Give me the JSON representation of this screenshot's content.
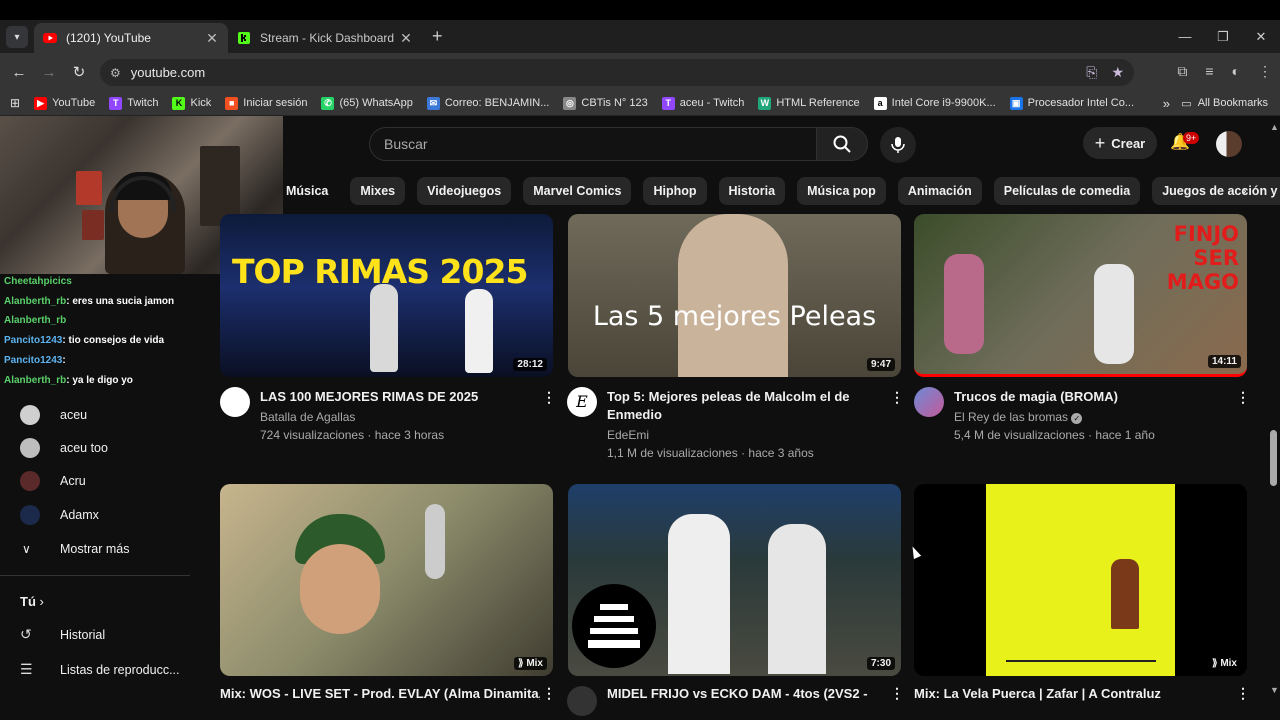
{
  "browser": {
    "tabs": [
      {
        "title": "(1201) YouTube",
        "favicon": "youtube-icon",
        "close": "✕"
      },
      {
        "title": "Stream - Kick Dashboard",
        "favicon": "kick-icon",
        "close": "✕"
      }
    ],
    "new_tab": "+",
    "url": "youtube.com",
    "bookmarks": [
      {
        "label": "YouTube",
        "color": "#ff0000",
        "glyph": "▶"
      },
      {
        "label": "Twitch",
        "color": "#9146ff",
        "glyph": "T"
      },
      {
        "label": "Kick",
        "color": "#53fc18",
        "glyph": "K"
      },
      {
        "label": "Iniciar sesión",
        "color": "#f25022",
        "glyph": "■"
      },
      {
        "label": "(65) WhatsApp",
        "color": "#25d366",
        "glyph": "✆"
      },
      {
        "label": "Correo: BENJAMIN...",
        "color": "#3c78d8",
        "glyph": "✉"
      },
      {
        "label": "CBTis N° 123",
        "color": "#888888",
        "glyph": "◎"
      },
      {
        "label": "aceu - Twitch",
        "color": "#9146ff",
        "glyph": "T"
      },
      {
        "label": "HTML Reference",
        "color": "#1fa67a",
        "glyph": "W"
      },
      {
        "label": "Intel Core i9-9900K...",
        "color": "#ffffff",
        "glyph": "a"
      },
      {
        "label": "Procesador Intel Co...",
        "color": "#1a73e8",
        "glyph": "▣"
      }
    ],
    "more_bookmarks": "»",
    "all_bookmarks": "All Bookmarks"
  },
  "stream_chat": [
    {
      "user": "Cheetahpicics",
      "msg": ""
    },
    {
      "user": "Alanberth_rb",
      "msg": ": eres una sucia jamon"
    },
    {
      "user": "Alanberth_rb",
      "msg": ""
    },
    {
      "user": "Pancito1243",
      "msg": ": tio consejos de vida"
    },
    {
      "user": "Pancito1243",
      "msg": ":"
    },
    {
      "user": "Alanberth_rb",
      "msg": ": ya le digo yo"
    }
  ],
  "sidebar": {
    "subscriptions": [
      {
        "name": "aceu",
        "color": "#cfcfcf"
      },
      {
        "name": "aceu too",
        "color": "#bdbdbd"
      },
      {
        "name": "Acru",
        "color": "#5a2a2a"
      },
      {
        "name": "Adamx",
        "color": "#1b2a4a"
      }
    ],
    "show_more": "Mostrar más",
    "you_section": "Tú",
    "history": "Historial",
    "playlists": "Listas de reproducc..."
  },
  "youtube": {
    "search_placeholder": "Buscar",
    "create_label": "Crear",
    "notif_badge": "9+",
    "chips": [
      "Música",
      "Mixes",
      "Videojuegos",
      "Marvel Comics",
      "Hiphop",
      "Historia",
      "Música pop",
      "Animación",
      "Películas de comedia",
      "Juegos de acción y aventuras"
    ],
    "videos_row1": [
      {
        "title": "LAS 100 MEJORES RIMAS DE 2025",
        "channel": "Batalla de Agallas",
        "meta": "724 visualizaciones · hace 3 horas",
        "duration": "28:12",
        "thumb_text": "TOP RIMAS 2025"
      },
      {
        "title": "Top 5: Mejores peleas de Malcolm el de Enmedio",
        "channel": "EdeEmi",
        "meta": "1,1 M de visualizaciones · hace 3 años",
        "duration": "9:47",
        "thumb_text": "Las 5 mejores Peleas"
      },
      {
        "title": "Trucos de magia (BROMA)",
        "channel": "El Rey de las bromas",
        "meta": "5,4 M de visualizaciones · hace 1 año",
        "duration": "14:11",
        "thumb_text": "FINJO SER MAGO"
      }
    ],
    "videos_row2": [
      {
        "title": "Mix: WOS - LIVE SET - Prod. EVLAY (Alma Dinamita,",
        "duration": "Mix"
      },
      {
        "title": "MIDEL FRIJO vs ECKO DAM - 4tos (2VS2 -",
        "duration": "7:30"
      },
      {
        "title": "Mix: La Vela Puerca | Zafar | A Contraluz",
        "duration": "Mix"
      }
    ]
  }
}
